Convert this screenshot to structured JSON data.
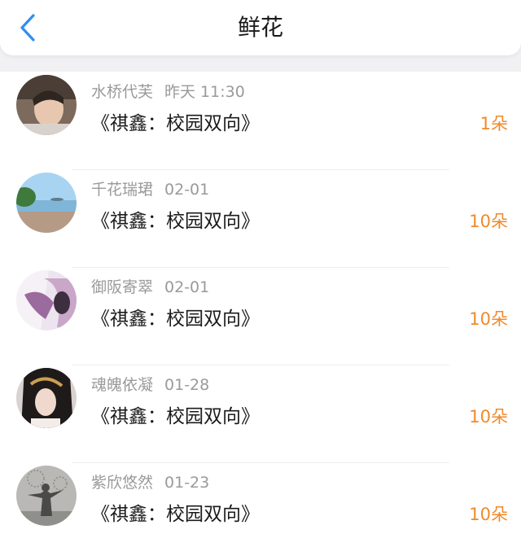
{
  "header": {
    "title": "鲜花",
    "back_icon": "chevron-left-icon",
    "accent": "#2f8ef3"
  },
  "gifts": [
    {
      "user": "水桥代芙",
      "time": "昨天 11:30",
      "book": "《祺鑫：校园双向》",
      "count": "1朵"
    },
    {
      "user": "千花瑞珺",
      "time": "02-01",
      "book": "《祺鑫：校园双向》",
      "count": "10朵"
    },
    {
      "user": "御阪寄翠",
      "time": "02-01",
      "book": "《祺鑫：校园双向》",
      "count": "10朵"
    },
    {
      "user": "魂魄依凝",
      "time": "01-28",
      "book": "《祺鑫：校园双向》",
      "count": "10朵"
    },
    {
      "user": "紫欣悠然",
      "time": "01-23",
      "book": "《祺鑫：校园双向》",
      "count": "10朵"
    }
  ],
  "colors": {
    "count": "#f08a2c",
    "meta": "#9a9a9a"
  }
}
